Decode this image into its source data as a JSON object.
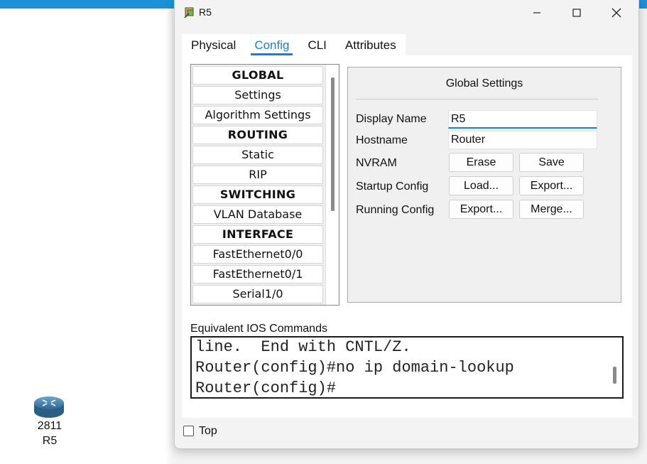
{
  "desktop": {
    "device_model": "2811",
    "device_name": "R5"
  },
  "window": {
    "title": "R5",
    "tabs": [
      {
        "label": "Physical",
        "active": false
      },
      {
        "label": "Config",
        "active": true
      },
      {
        "label": "CLI",
        "active": false
      },
      {
        "label": "Attributes",
        "active": false
      }
    ],
    "nav": {
      "items": [
        {
          "label": "GLOBAL",
          "header": true
        },
        {
          "label": "Settings",
          "header": false
        },
        {
          "label": "Algorithm Settings",
          "header": false
        },
        {
          "label": "ROUTING",
          "header": true
        },
        {
          "label": "Static",
          "header": false
        },
        {
          "label": "RIP",
          "header": false
        },
        {
          "label": "SWITCHING",
          "header": true
        },
        {
          "label": "VLAN Database",
          "header": false
        },
        {
          "label": "INTERFACE",
          "header": true
        },
        {
          "label": "FastEthernet0/0",
          "header": false
        },
        {
          "label": "FastEthernet0/1",
          "header": false
        },
        {
          "label": "Serial1/0",
          "header": false
        }
      ]
    },
    "global_settings": {
      "title": "Global Settings",
      "display_name_label": "Display Name",
      "display_name_value": "R5",
      "hostname_label": "Hostname",
      "hostname_value": "Router",
      "nvram_label": "NVRAM",
      "erase_label": "Erase",
      "save_label": "Save",
      "startup_config_label": "Startup Config",
      "load_label": "Load...",
      "startup_export_label": "Export...",
      "running_config_label": "Running Config",
      "running_export_label": "Export...",
      "merge_label": "Merge..."
    },
    "ios": {
      "label": "Equivalent IOS Commands",
      "lines": [
        "line.  End with CNTL/Z.",
        "Router(config)#no ip domain-lookup",
        "Router(config)#"
      ]
    },
    "top_checkbox_label": "Top"
  },
  "colors": {
    "accent": "#1a7fd0",
    "taskbar": "#1e8fd9"
  },
  "icons": {
    "router": "router-icon",
    "app": "packet-tracer-app-icon",
    "minimize": "minimize-icon",
    "maximize": "maximize-icon",
    "close": "close-icon"
  }
}
